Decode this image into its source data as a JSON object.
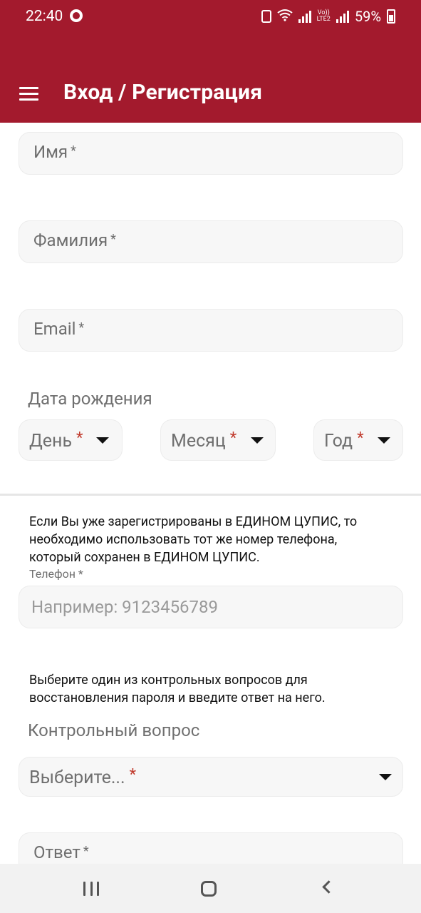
{
  "status_bar": {
    "time": "22:40",
    "battery": "59%",
    "icons": [
      "app-shield-icon",
      "lock-icon",
      "wifi-icon",
      "signal-icon",
      "volte-icon",
      "battery-icon"
    ]
  },
  "app_bar": {
    "title": "Вход / Регистрация",
    "menu_icon": "hamburger-menu-icon"
  },
  "form": {
    "first_name": {
      "label": "Имя",
      "required": "*"
    },
    "last_name": {
      "label": "Фамилия",
      "required": "*"
    },
    "email": {
      "label": "Email",
      "required": "*"
    },
    "birth_date": {
      "label": "Дата рождения",
      "day": {
        "label": "День",
        "required": "*"
      },
      "month": {
        "label": "Месяц",
        "required": "*"
      },
      "year": {
        "label": "Год",
        "required": "*"
      }
    },
    "phone_info": "Если Вы уже зарегистрированы в ЕДИНОМ ЦУПИС, то необходимо использовать тот же номер телефона, который сохранен в ЕДИНОМ ЦУПИС.",
    "phone": {
      "label": "Телефон",
      "required": "*",
      "placeholder": "Например: 9123456789"
    },
    "question_info": "Выберите один из контрольных вопросов для восстановления пароля и введите ответ на него.",
    "security_question": {
      "label": "Контрольный вопрос",
      "value": "Выберите...",
      "required": "*"
    },
    "answer": {
      "label": "Ответ",
      "required": "*"
    }
  },
  "colors": {
    "brand": "#a31a2d",
    "field_bg": "#f7f7f7",
    "required_accent": "#c0392b"
  },
  "nav_bar": {
    "icons": [
      "recent-apps-icon",
      "home-icon",
      "back-icon"
    ]
  }
}
